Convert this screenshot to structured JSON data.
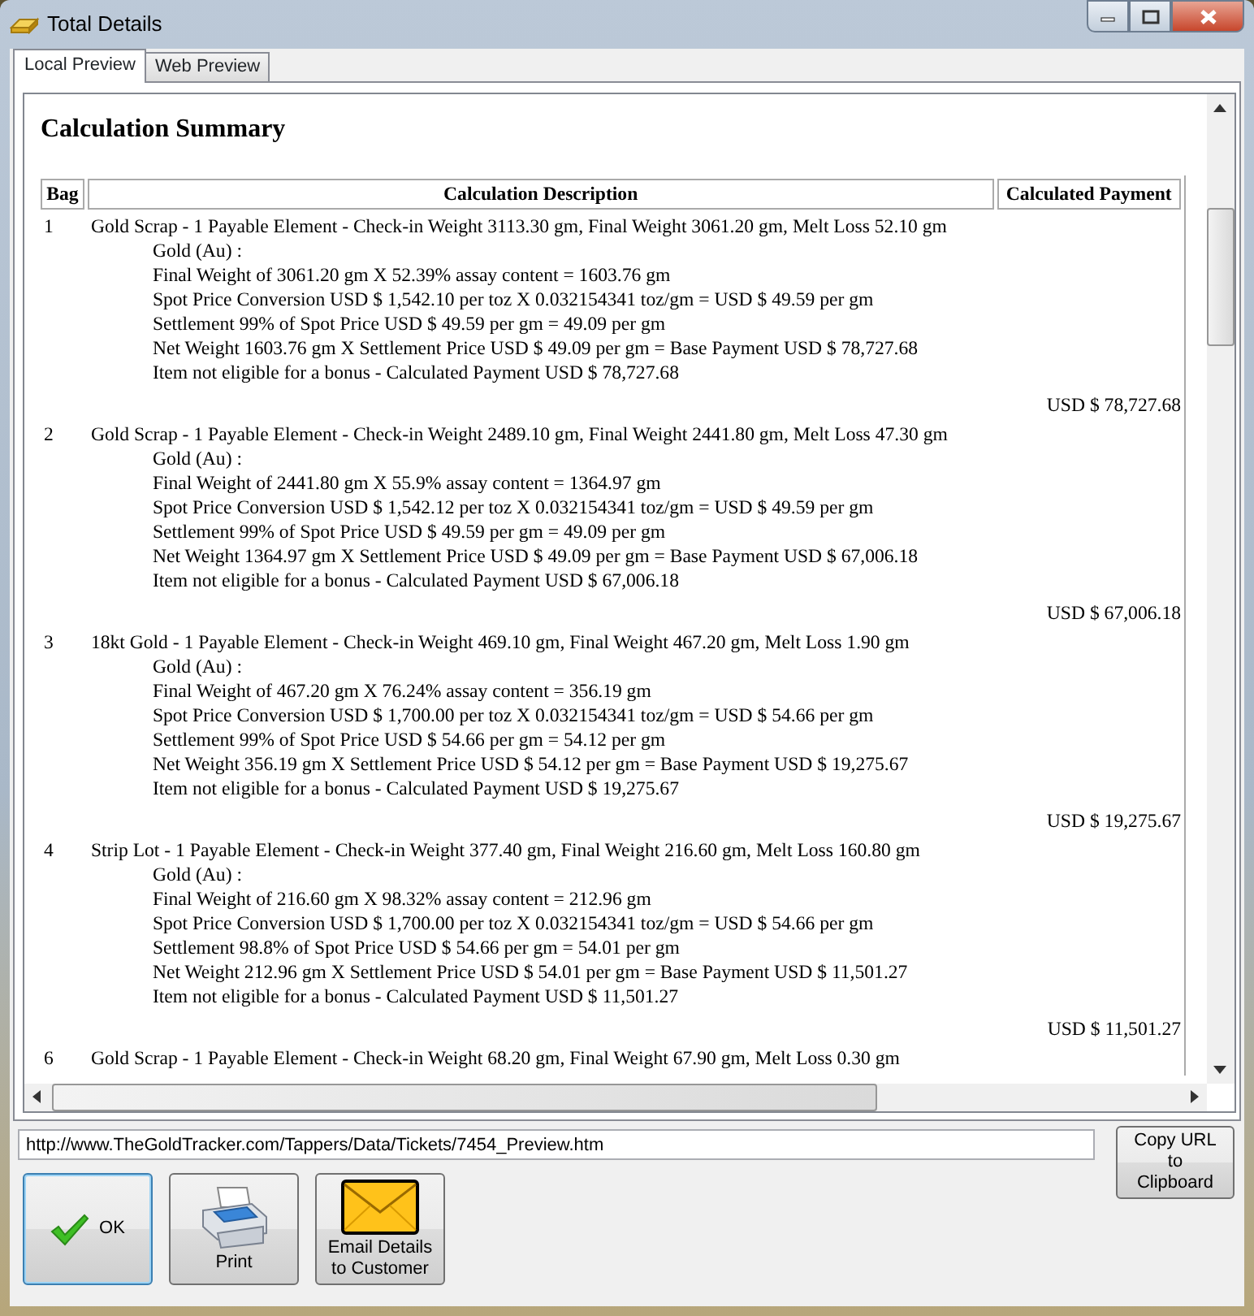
{
  "window": {
    "title": "Total Details"
  },
  "tabs": [
    {
      "label": "Local Preview",
      "selected": true
    },
    {
      "label": "Web Preview",
      "selected": false
    }
  ],
  "preview": {
    "heading": "Calculation Summary",
    "columns": [
      "Bag",
      "Calculation Description",
      "Calculated Payment"
    ],
    "rows": [
      {
        "bag": "1",
        "summary": "Gold Scrap - 1 Payable Element - Check-in Weight 3113.30 gm, Final Weight 3061.20 gm, Melt Loss 52.10 gm",
        "lines": [
          "Gold (Au) :",
          "Final Weight of 3061.20 gm X 52.39% assay content = 1603.76 gm",
          "Spot Price Conversion USD $ 1,542.10 per toz X 0.032154341 toz/gm = USD $ 49.59 per gm",
          "Settlement 99% of Spot Price USD $ 49.59 per gm = 49.09 per gm",
          "Net Weight 1603.76 gm X Settlement Price USD $ 49.09 per gm = Base Payment USD $ 78,727.68",
          "Item not eligible for a bonus - Calculated Payment USD $ 78,727.68"
        ],
        "payment": "USD $ 78,727.68"
      },
      {
        "bag": "2",
        "summary": "Gold Scrap - 1 Payable Element - Check-in Weight 2489.10 gm, Final Weight 2441.80 gm, Melt Loss 47.30 gm",
        "lines": [
          "Gold (Au) :",
          "Final Weight of 2441.80 gm X 55.9% assay content = 1364.97 gm",
          "Spot Price Conversion USD $ 1,542.12 per toz X 0.032154341 toz/gm = USD $ 49.59 per gm",
          "Settlement 99% of Spot Price USD $ 49.59 per gm = 49.09 per gm",
          "Net Weight 1364.97 gm X Settlement Price USD $ 49.09 per gm = Base Payment USD $ 67,006.18",
          "Item not eligible for a bonus - Calculated Payment USD $ 67,006.18"
        ],
        "payment": "USD $ 67,006.18"
      },
      {
        "bag": "3",
        "summary": "18kt Gold - 1 Payable Element - Check-in Weight 469.10 gm, Final Weight 467.20 gm, Melt Loss 1.90 gm",
        "lines": [
          "Gold (Au) :",
          "Final Weight of 467.20 gm X 76.24% assay content = 356.19 gm",
          "Spot Price Conversion USD $ 1,700.00 per toz X 0.032154341 toz/gm = USD $ 54.66 per gm",
          "Settlement 99% of Spot Price USD $ 54.66 per gm = 54.12 per gm",
          "Net Weight 356.19 gm X Settlement Price USD $ 54.12 per gm = Base Payment USD $ 19,275.67",
          "Item not eligible for a bonus - Calculated Payment USD $ 19,275.67"
        ],
        "payment": "USD $ 19,275.67"
      },
      {
        "bag": "4",
        "summary": "Strip Lot - 1 Payable Element - Check-in Weight 377.40 gm, Final Weight 216.60 gm, Melt Loss 160.80 gm",
        "lines": [
          "Gold (Au) :",
          "Final Weight of 216.60 gm X 98.32% assay content = 212.96 gm",
          "Spot Price Conversion USD $ 1,700.00 per toz X 0.032154341 toz/gm = USD $ 54.66 per gm",
          "Settlement 98.8% of Spot Price USD $ 54.66 per gm = 54.01 per gm",
          "Net Weight 212.96 gm X Settlement Price USD $ 54.01 per gm = Base Payment USD $ 11,501.27",
          "Item not eligible for a bonus - Calculated Payment USD $ 11,501.27"
        ],
        "payment": "USD $ 11,501.27"
      },
      {
        "bag": "6",
        "summary": "Gold Scrap - 1 Payable Element - Check-in Weight 68.20 gm, Final Weight 67.90 gm, Melt Loss 0.30 gm"
      }
    ]
  },
  "url": "http://www.TheGoldTracker.com/Tappers/Data/Tickets/7454_Preview.htm",
  "copy_button": "Copy URL to Clipboard",
  "buttons": [
    {
      "kind": "ok",
      "label": "OK",
      "default": true
    },
    {
      "kind": "print",
      "label": "Print",
      "default": false
    },
    {
      "kind": "email",
      "label": "Email Details to Customer",
      "default": false
    }
  ]
}
